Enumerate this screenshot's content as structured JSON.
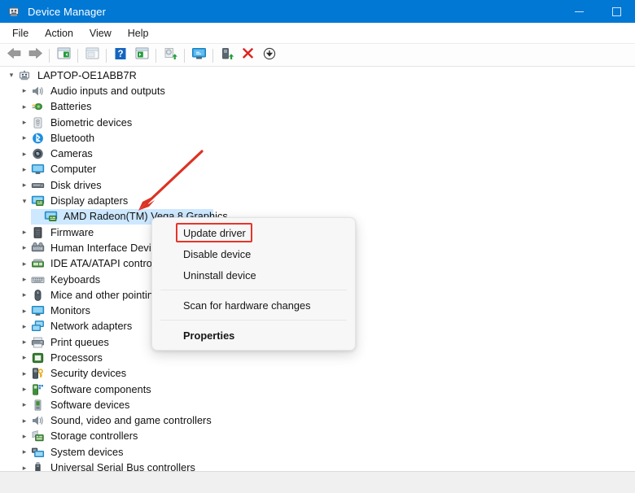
{
  "window": {
    "title": "Device Manager",
    "icon": "device-manager-icon",
    "controls": {
      "minimize": "Minimize",
      "maximize": "Maximize"
    },
    "titlebar_color": "#0078d4"
  },
  "menubar": {
    "items": [
      {
        "label": "File",
        "name": "menu-file"
      },
      {
        "label": "Action",
        "name": "menu-action"
      },
      {
        "label": "View",
        "name": "menu-view"
      },
      {
        "label": "Help",
        "name": "menu-help"
      }
    ]
  },
  "toolbar": {
    "buttons": [
      {
        "icon": "back-arrow-icon",
        "name": "toolbar-back"
      },
      {
        "icon": "forward-arrow-icon",
        "name": "toolbar-forward"
      },
      {
        "icon": "show-hide-console-tree-icon",
        "name": "toolbar-console-tree"
      },
      {
        "icon": "show-hide-action-pane-icon",
        "name": "toolbar-action-pane"
      },
      {
        "icon": "help-icon",
        "name": "toolbar-help"
      },
      {
        "icon": "properties-icon",
        "name": "toolbar-properties"
      },
      {
        "icon": "update-driver-icon",
        "name": "toolbar-update-driver"
      },
      {
        "icon": "scan-for-hardware-changes-icon",
        "name": "toolbar-scan-hardware"
      },
      {
        "icon": "enable-device-icon",
        "name": "toolbar-enable-device"
      },
      {
        "icon": "uninstall-device-icon",
        "name": "toolbar-uninstall-device"
      },
      {
        "icon": "disable-device-icon",
        "name": "toolbar-disable-device"
      }
    ]
  },
  "tree": {
    "root": {
      "label": "LAPTOP-OE1ABB7R",
      "icon": "computer-root-icon",
      "expanded": true
    },
    "items": [
      {
        "label": "Audio inputs and outputs",
        "icon": "speaker-icon",
        "expanded": false,
        "indent": 1
      },
      {
        "label": "Batteries",
        "icon": "battery-icon",
        "expanded": false,
        "indent": 1
      },
      {
        "label": "Biometric devices",
        "icon": "fingerprint-icon",
        "expanded": false,
        "indent": 1
      },
      {
        "label": "Bluetooth",
        "icon": "bluetooth-icon",
        "expanded": false,
        "indent": 1
      },
      {
        "label": "Cameras",
        "icon": "camera-icon",
        "expanded": false,
        "indent": 1
      },
      {
        "label": "Computer",
        "icon": "monitor-icon",
        "expanded": false,
        "indent": 1
      },
      {
        "label": "Disk drives",
        "icon": "disk-drive-icon",
        "expanded": false,
        "indent": 1
      },
      {
        "label": "Display adapters",
        "icon": "display-adapter-icon",
        "expanded": true,
        "indent": 1
      },
      {
        "label": "AMD Radeon(TM) Vega 8 Graphics",
        "icon": "display-adapter-icon",
        "expanded": false,
        "indent": 2,
        "selected": true
      },
      {
        "label": "Firmware",
        "icon": "firmware-icon",
        "expanded": false,
        "indent": 1
      },
      {
        "label": "Human Interface Devices",
        "icon": "hid-icon",
        "expanded": false,
        "indent": 1
      },
      {
        "label": "IDE ATA/ATAPI controllers",
        "icon": "ide-controller-icon",
        "expanded": false,
        "indent": 1
      },
      {
        "label": "Keyboards",
        "icon": "keyboard-icon",
        "expanded": false,
        "indent": 1
      },
      {
        "label": "Mice and other pointing devices",
        "icon": "mouse-icon",
        "expanded": false,
        "indent": 1
      },
      {
        "label": "Monitors",
        "icon": "monitor-icon",
        "expanded": false,
        "indent": 1
      },
      {
        "label": "Network adapters",
        "icon": "network-adapter-icon",
        "expanded": false,
        "indent": 1
      },
      {
        "label": "Print queues",
        "icon": "printer-icon",
        "expanded": false,
        "indent": 1
      },
      {
        "label": "Processors",
        "icon": "processor-icon",
        "expanded": false,
        "indent": 1
      },
      {
        "label": "Security devices",
        "icon": "security-device-icon",
        "expanded": false,
        "indent": 1
      },
      {
        "label": "Software components",
        "icon": "software-component-icon",
        "expanded": false,
        "indent": 1
      },
      {
        "label": "Software devices",
        "icon": "software-device-icon",
        "expanded": false,
        "indent": 1
      },
      {
        "label": "Sound, video and game controllers",
        "icon": "speaker-icon",
        "expanded": false,
        "indent": 1
      },
      {
        "label": "Storage controllers",
        "icon": "storage-controller-icon",
        "expanded": false,
        "indent": 1
      },
      {
        "label": "System devices",
        "icon": "system-device-icon",
        "expanded": false,
        "indent": 1
      },
      {
        "label": "Universal Serial Bus controllers",
        "icon": "usb-controller-icon",
        "expanded": false,
        "indent": 1
      }
    ],
    "selection_color": "#cde8ff"
  },
  "context_menu": {
    "items": [
      {
        "label": "Update driver",
        "name": "ctx-update-driver",
        "highlighted": true,
        "bold": false
      },
      {
        "label": "Disable device",
        "name": "ctx-disable-device",
        "highlighted": false,
        "bold": false
      },
      {
        "label": "Uninstall device",
        "name": "ctx-uninstall-device",
        "highlighted": false,
        "bold": false
      },
      {
        "separator": true
      },
      {
        "label": "Scan for hardware changes",
        "name": "ctx-scan-hardware-changes",
        "highlighted": false,
        "bold": false
      },
      {
        "separator": true
      },
      {
        "label": "Properties",
        "name": "ctx-properties",
        "highlighted": false,
        "bold": true
      }
    ]
  },
  "annotation": {
    "arrow": "red-arrow-pointing-to-display-adapters",
    "color": "#dc3223",
    "highlight_box_color": "#e8342a"
  }
}
